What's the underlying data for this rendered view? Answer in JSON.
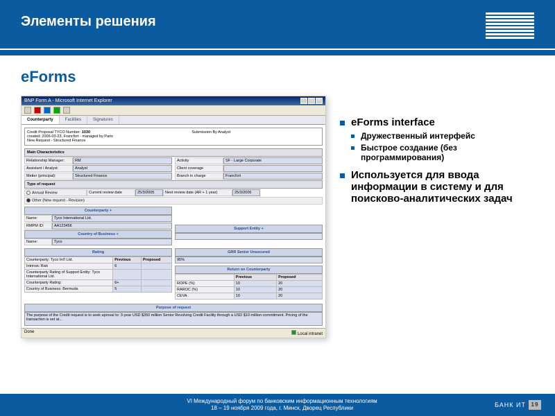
{
  "slide": {
    "header_title": "Элементы решения",
    "section_title": "eForms"
  },
  "bullets": {
    "b1": "eForms interface",
    "b1s1": "Дружественный интерфейс",
    "b1s2": "Быстрое создание (без программирования)",
    "b2": "Используется для ввода информации в систему и для поисково-аналитических задач"
  },
  "screenshot": {
    "window_title": "BNP Form A - Microsoft Internet Explorer",
    "tabs": {
      "t1": "Counterparty",
      "t2": "Facilities",
      "t3": "Signatures"
    },
    "credit_proposal_label": "Credit Proposal TYCO Number:",
    "credit_proposal_number": "1030",
    "credit_created": "created: 2006-03-23, Francfort - managed by Paris",
    "credit_newreq": "New Request - Structured Finance",
    "submission_label": "Submission By Analyst",
    "main_char_hdr": "Main Characteristics",
    "rm_label": "Relationship Manager:",
    "rm_val": "RM",
    "aa_label": "Assistant / Analyst:",
    "aa_val": "Analyst",
    "metier_label": "Metier (principal):",
    "metier_val": "Structured Finance",
    "activity_label": "Activity",
    "activity_val": "SF - Large Corporate",
    "cc_label": "Client coverage",
    "branch_label": "Branch in charge",
    "branch_val": "Francfort",
    "type_req_hdr": "Type of request",
    "annual_review": "Annual Review",
    "current_review_label": "Current review date",
    "current_review_val": "25/3/2005",
    "next_review_label": "Next review date (AR + 1 year)",
    "next_review_val": "25/3/2006",
    "other_req": "Other (New request - Revision)",
    "counterparty_hdr": "Counterparty",
    "name_label": "Name:",
    "name_val": "Tyco International Ltd.",
    "rmpm_label": "RMPM ID:",
    "rmpm_val": "AA123456",
    "cob_hdr": "Country of Business",
    "cob_name": "Name:",
    "cob_val": "Tyco",
    "support_entity_hdr": "Support Entity",
    "rating_hdr": "Rating",
    "cp_rating_label": "Counterparty: Tyco Int'l Ltd.",
    "prev_hdr": "Previous",
    "prop_hdr": "Proposed",
    "intrinsic_label": "Intrinsic Risk",
    "intrinsic_val": "6",
    "cp_support_label": "Counterparty Rating of Support Entity:",
    "cp_support_name": "Tyco International Ltd.",
    "cp_rating2_label": "Counterparty Rating:",
    "cp_rating2_val": "6+",
    "cob2_label": "Country of Business: Bermuda",
    "cob2_val": "5",
    "grr_hdr": "GRR Senior Unsecured",
    "grr_val": "95%",
    "return_hdr": "Return on Counterparty",
    "rope_label": "ROPE (%)",
    "rope_prev": "10",
    "rope_prop": "20",
    "raroc_label": "RAROC (%)",
    "raroc_prev": "10",
    "raroc_prop": "20",
    "ceva_label": "CEVA",
    "ceva_prev": "10",
    "ceva_prop": "20",
    "purpose_hdr": "Purpose of request",
    "purpose_text": "The purpose of the Credit request is to seek aproval to: 3-year USD $350 million Senior Revolving Credit Facility through a USD $10 million commitment. Pricing of the transaction is set at...",
    "status_done": "Done",
    "status_zone": "Local intranet"
  },
  "footer": {
    "line1": "VI Международный форум по банковским информационным технологиям",
    "line2": "18 – 19 ноября 2009 года, г. Минск, Дворец Республики",
    "brand": "БАНК ИТ",
    "page": "19"
  }
}
